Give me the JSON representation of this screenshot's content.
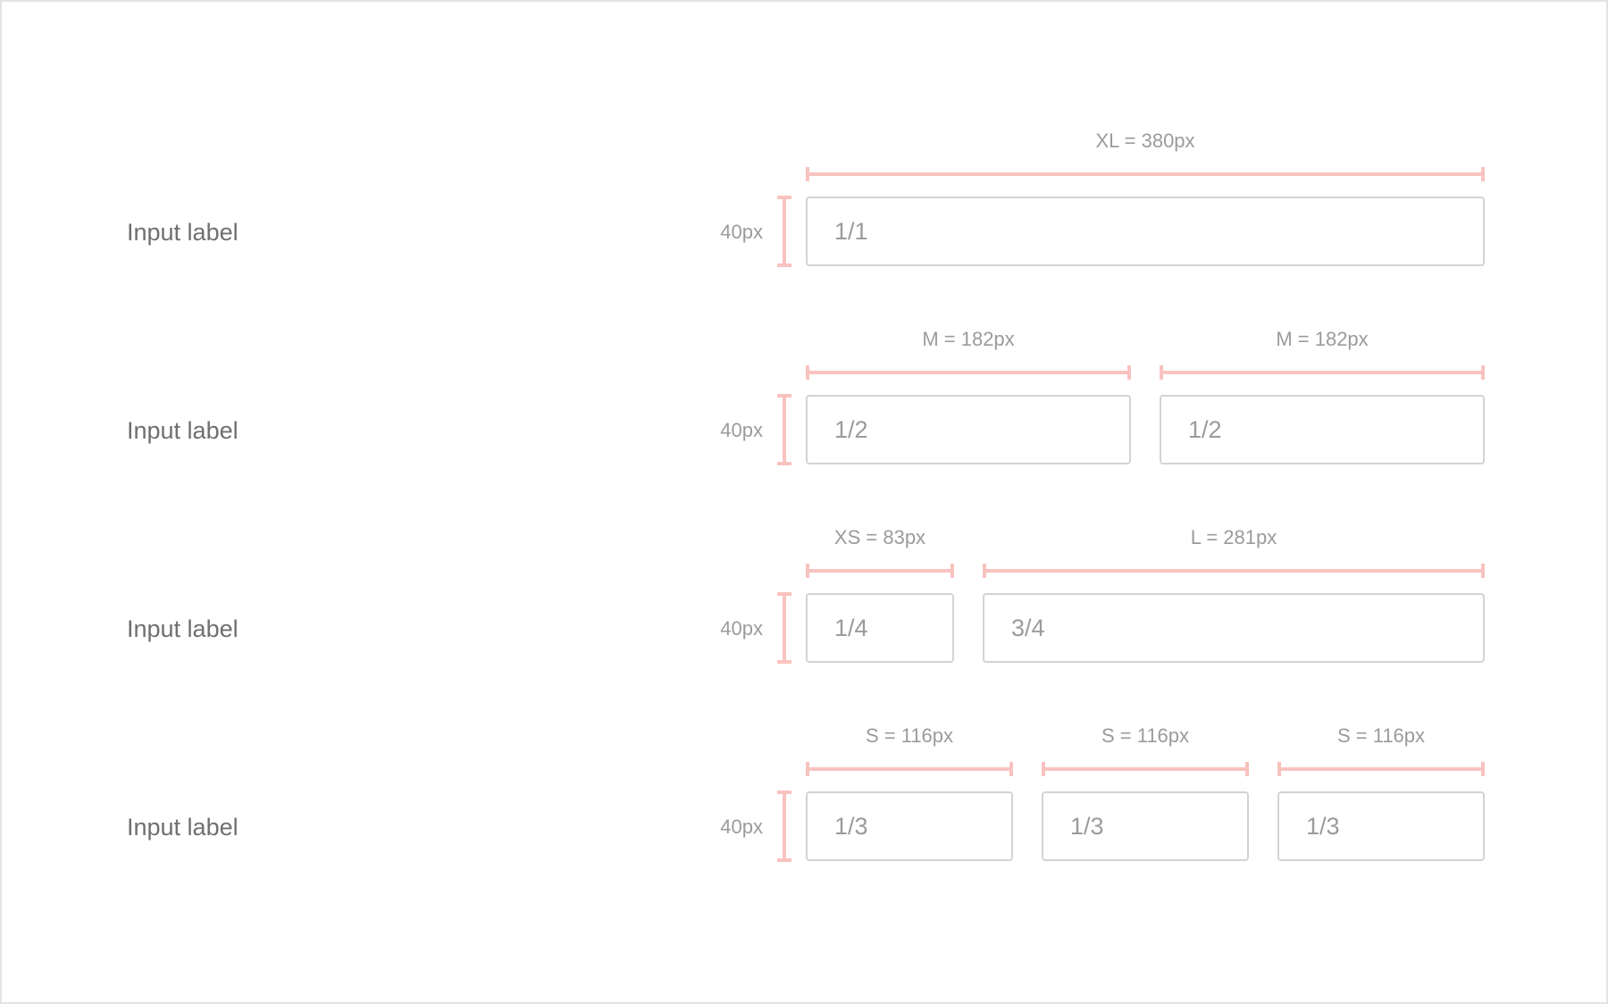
{
  "rows": [
    {
      "label": "Input label",
      "height_label": "40px",
      "fields": [
        {
          "size_label": "XL = 380px",
          "value": "1/1"
        }
      ]
    },
    {
      "label": "Input label",
      "height_label": "40px",
      "fields": [
        {
          "size_label": "M = 182px",
          "value": "1/2"
        },
        {
          "size_label": "M = 182px",
          "value": "1/2"
        }
      ]
    },
    {
      "label": "Input label",
      "height_label": "40px",
      "fields": [
        {
          "size_label": "XS = 83px",
          "value": "1/4"
        },
        {
          "size_label": "L = 281px",
          "value": "3/4"
        }
      ]
    },
    {
      "label": "Input label",
      "height_label": "40px",
      "fields": [
        {
          "size_label": "S = 116px",
          "value": "1/3"
        },
        {
          "size_label": "S = 116px",
          "value": "1/3"
        },
        {
          "size_label": "S = 116px",
          "value": "1/3"
        }
      ]
    }
  ],
  "colors": {
    "measure_line": "#f8c3bf",
    "field_border": "#d3d3d3",
    "label_text": "#6f6f6f",
    "annotation_text": "#9b9b9b"
  }
}
